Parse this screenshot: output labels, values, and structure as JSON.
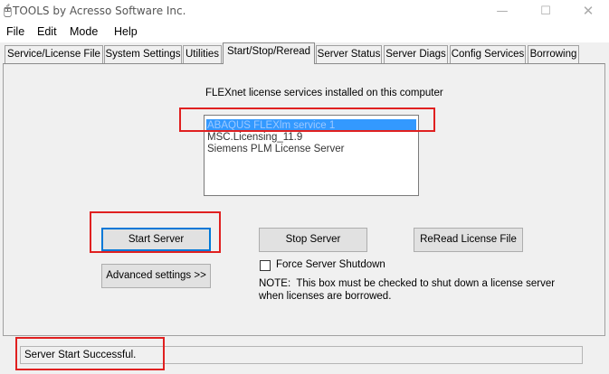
{
  "window": {
    "title": "TOOLS by Acresso Software Inc.",
    "minimize_icon": "minimize-icon",
    "maximize_icon": "maximize-icon",
    "close_icon": "close-icon"
  },
  "menu": {
    "items": [
      {
        "label": "File"
      },
      {
        "label": "Edit"
      },
      {
        "label": "Mode"
      },
      {
        "label": "Help"
      }
    ]
  },
  "tabs": [
    {
      "label": "Service/License File",
      "active": false
    },
    {
      "label": "System Settings",
      "active": false
    },
    {
      "label": "Utilities",
      "active": false
    },
    {
      "label": "Start/Stop/Reread",
      "active": true
    },
    {
      "label": "Server Status",
      "active": false
    },
    {
      "label": "Server Diags",
      "active": false
    },
    {
      "label": "Config Services",
      "active": false
    },
    {
      "label": "Borrowing",
      "active": false
    }
  ],
  "panel": {
    "services_label": "FLEXnet license services installed on this computer",
    "services": [
      {
        "label": "ABAQUS FLEXlm service 1",
        "selected": true
      },
      {
        "label": "MSC.Licensing_11.9",
        "selected": false
      },
      {
        "label": "Siemens PLM License Server",
        "selected": false
      }
    ],
    "start_button": "Start Server",
    "stop_button": "Stop Server",
    "reread_button": "ReRead License File",
    "advanced_button": "Advanced settings >>",
    "force_shutdown_label": "Force Server Shutdown",
    "force_shutdown_checked": false,
    "note_line1": "NOTE:  This box must be checked to shut down a license server",
    "note_line2": "when licenses are borrowed."
  },
  "status": {
    "text": "Server Start Successful."
  },
  "colors": {
    "selection": "#3399ff",
    "highlight": "#e02020",
    "default_button_border": "#0078d7"
  }
}
